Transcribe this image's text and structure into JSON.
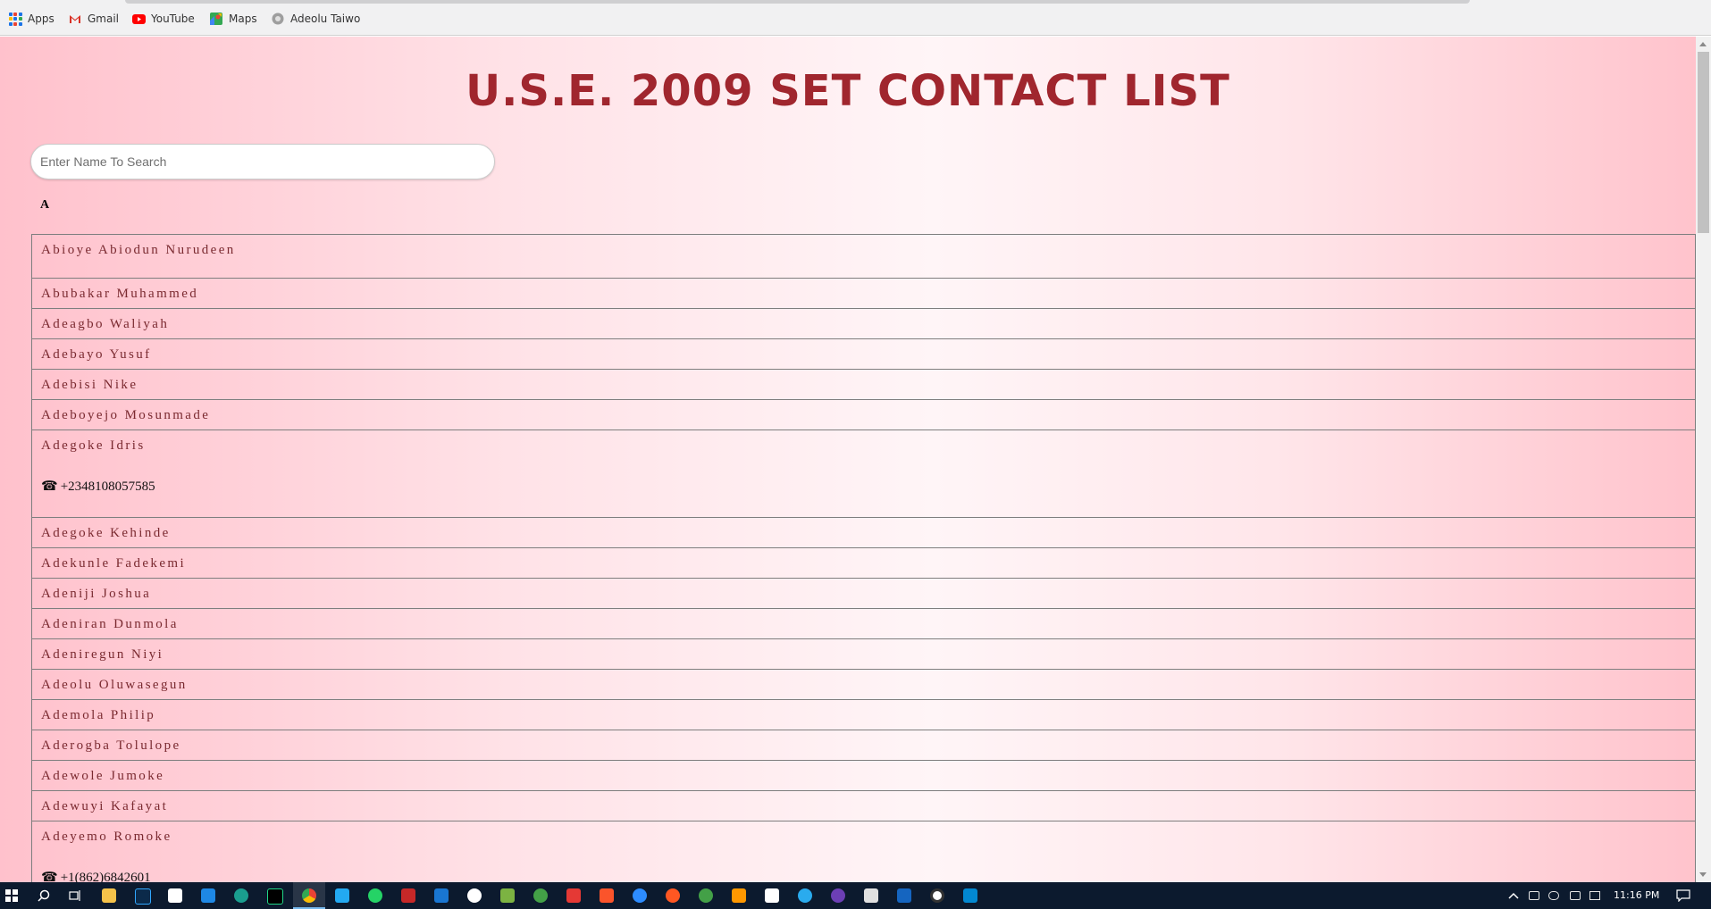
{
  "bookmarks": [
    {
      "label": "Apps",
      "icon": "apps-grid-icon"
    },
    {
      "label": "Gmail",
      "icon": "gmail-icon"
    },
    {
      "label": "YouTube",
      "icon": "youtube-icon"
    },
    {
      "label": "Maps",
      "icon": "maps-icon"
    },
    {
      "label": "Adeolu Taiwo",
      "icon": "profile-globe-icon"
    }
  ],
  "page": {
    "title": "U.S.E. 2009 SET CONTACT LIST",
    "search_placeholder": "Enter Name To Search",
    "group_letter": "A"
  },
  "contacts": [
    {
      "name": "Abioye Abiodun Nurudeen",
      "phone": ""
    },
    {
      "name": "Abubakar Muhammed",
      "phone": ""
    },
    {
      "name": "Adeagbo Waliyah",
      "phone": ""
    },
    {
      "name": "Adebayo Yusuf",
      "phone": ""
    },
    {
      "name": "Adebisi Nike",
      "phone": ""
    },
    {
      "name": "Adeboyejo Mosunmade",
      "phone": ""
    },
    {
      "name": "Adegoke Idris",
      "phone": "+2348108057585"
    },
    {
      "name": "Adegoke Kehinde",
      "phone": ""
    },
    {
      "name": "Adekunle Fadekemi",
      "phone": ""
    },
    {
      "name": "Adeniji Joshua",
      "phone": ""
    },
    {
      "name": "Adeniran Dunmola",
      "phone": ""
    },
    {
      "name": "Adeniregun Niyi",
      "phone": ""
    },
    {
      "name": "Adeolu Oluwasegun",
      "phone": ""
    },
    {
      "name": "Ademola Philip",
      "phone": ""
    },
    {
      "name": "Aderogba Tolulope",
      "phone": ""
    },
    {
      "name": "Adewole Jumoke",
      "phone": ""
    },
    {
      "name": "Adewuyi Kafayat",
      "phone": ""
    },
    {
      "name": "Adeyemo Romoke",
      "phone": "+1(862)6842601"
    }
  ],
  "phone_icon": "☎",
  "taskbar": {
    "time": "11:16 PM"
  },
  "colors": {
    "title": "#a0262e",
    "name_text": "#7a2a30",
    "background_edge": "#ffc1cc",
    "background_center": "#fff5f7"
  }
}
